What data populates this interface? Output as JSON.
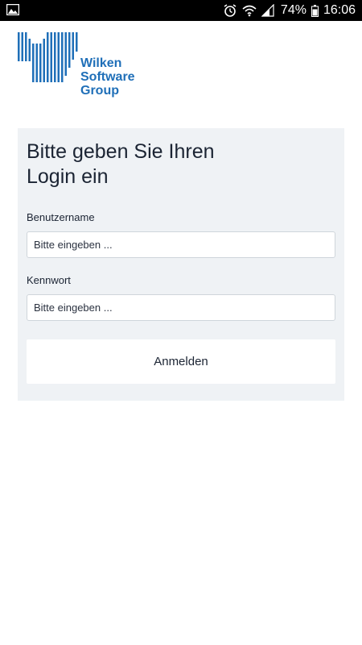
{
  "status_bar": {
    "battery": "74%",
    "time": "16:06",
    "icons": [
      "image-icon",
      "alarm-icon",
      "wifi-icon",
      "signal-icon",
      "battery-icon"
    ]
  },
  "logo": {
    "line1": "Wilken",
    "line2": "Software",
    "line3": "Group",
    "color": "#1f6fb8"
  },
  "login": {
    "title_line1": "Bitte geben Sie Ihren",
    "title_line2": "Login ein",
    "username_label": "Benutzername",
    "username_placeholder": "Bitte eingeben ...",
    "password_label": "Kennwort",
    "password_placeholder": "Bitte eingeben ...",
    "submit_label": "Anmelden"
  },
  "colors": {
    "card_background": "#eff2f5",
    "text": "#1b2433",
    "status_bar": "#000000"
  }
}
